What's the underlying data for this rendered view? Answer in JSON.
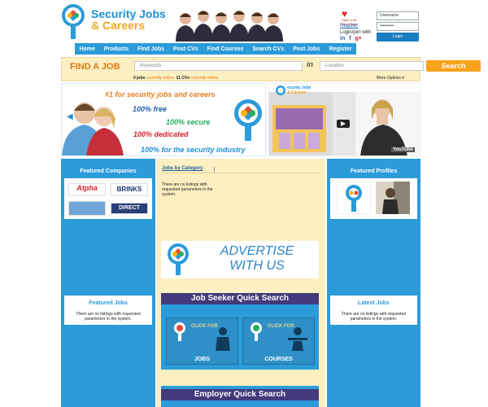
{
  "header": {
    "logo_line1": "Security Jobs",
    "logo_line2": "& Careers",
    "heart_text1": "Save a life",
    "heart_text2": "Give Blood",
    "register_link": "Register",
    "login_join": "Login/join with",
    "username_placeholder": "Username",
    "password_value": "••••••••••",
    "login_button": "Login",
    "social": [
      "in",
      "f",
      "g+"
    ]
  },
  "nav": [
    "Home",
    "Products",
    "Find Jobs",
    "Post CVs",
    "Find Courses",
    "Search CVs",
    "Post Jobs",
    "Register"
  ],
  "find": {
    "title": "FIND A JOB",
    "keywords_placeholder": "Keywords",
    "in_label": "in",
    "location_placeholder": "Location",
    "search_button": "Search",
    "jobs_count": "0 jobs",
    "jobs_online": "currently online",
    "cvs_count": "11 CVs",
    "cvs_online": "currently online",
    "more_options": "More Options ▾"
  },
  "banner": {
    "tagline": "#1 for security jobs and careers",
    "free": "100% free",
    "secure": "100% secure",
    "dedicated": "100% dedicated",
    "industry": "100% for the security industry"
  },
  "video": {
    "logo_line1": "ecurity Jobs",
    "logo_line2": "& Careers",
    "youtube": "YouTube"
  },
  "left": {
    "featured_companies": "Featured Companies",
    "companies": [
      "Atpha",
      "BRINKS",
      "",
      "DIRECT"
    ],
    "featured_jobs": "Featured Jobs",
    "no_listings": "There are no listings with requested parameters in the system."
  },
  "center": {
    "tab_label": "Jobs by Category",
    "no_listings": "There are no listings with requested parameters in the system.",
    "advert": "ADVERTISE WITH US",
    "job_seeker_title": "Job Seeker Quick Search",
    "click_for": "CLICK FOR",
    "jobs_label": "JOBS",
    "courses_label": "COURSES",
    "employer_title": "Employer Quick Search"
  },
  "right": {
    "featured_profiles": "Featured Profiles",
    "latest_jobs": "Latest Jobs",
    "no_listings": "There are no listings with requested parameters in the system."
  },
  "colors": {
    "brand_blue": "#2b9bd9",
    "orange": "#f7a21b",
    "cream": "#fcefc1",
    "purple": "#423a7a"
  }
}
